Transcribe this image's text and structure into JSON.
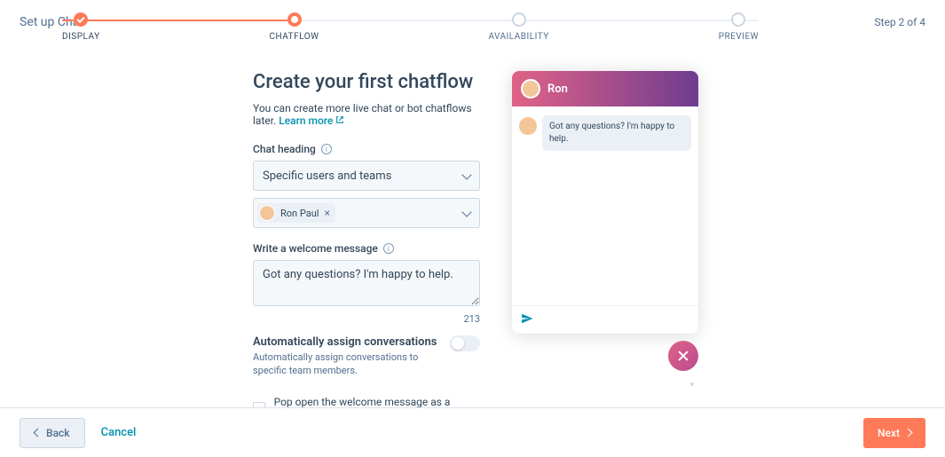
{
  "header": {
    "title": "Set up Chat",
    "step_text": "Step 2 of 4"
  },
  "steps": [
    {
      "label": "DISPLAY",
      "status": "done"
    },
    {
      "label": "CHATFLOW",
      "status": "current"
    },
    {
      "label": "AVAILABILITY",
      "status": "upcoming"
    },
    {
      "label": "PREVIEW",
      "status": "upcoming"
    }
  ],
  "page": {
    "heading": "Create your first chatflow",
    "subline": "You can create more live chat or bot chatflows later. ",
    "learn_more": "Learn more"
  },
  "form": {
    "chat_heading_label": "Chat heading",
    "chat_heading_select": "Specific users and teams",
    "tag_user": "Ron Paul",
    "welcome_label": "Write a welcome message",
    "welcome_value": "Got any questions? I'm happy to help.",
    "char_count": "213",
    "auto_assign_title": "Automatically assign conversations",
    "auto_assign_desc": "Automatically assign conversations to specific team members.",
    "checkbox_label": "Pop open the welcome message as a prompt"
  },
  "preview": {
    "name": "Ron",
    "message": "Got any questions? I'm happy to help."
  },
  "footer": {
    "back": "Back",
    "cancel": "Cancel",
    "next": "Next"
  }
}
